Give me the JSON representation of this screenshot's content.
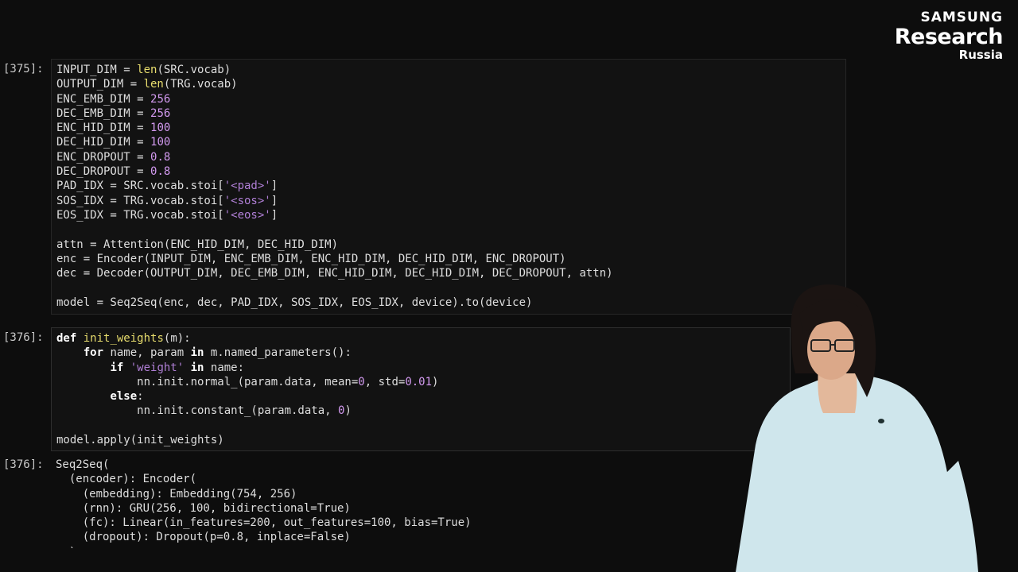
{
  "logo": {
    "line1": "SAMSUNG",
    "line2": "Research",
    "line3": "Russia"
  },
  "cells": {
    "c375": {
      "prompt": "[375]:",
      "lines": [
        [
          {
            "t": "INPUT_DIM = "
          },
          {
            "t": "len",
            "c": "fn"
          },
          {
            "t": "(SRC.vocab)"
          }
        ],
        [
          {
            "t": "OUTPUT_DIM = "
          },
          {
            "t": "len",
            "c": "fn"
          },
          {
            "t": "(TRG.vocab)"
          }
        ],
        [
          {
            "t": "ENC_EMB_DIM = "
          },
          {
            "t": "256",
            "c": "num"
          }
        ],
        [
          {
            "t": "DEC_EMB_DIM = "
          },
          {
            "t": "256",
            "c": "num"
          }
        ],
        [
          {
            "t": "ENC_HID_DIM = "
          },
          {
            "t": "100",
            "c": "num"
          }
        ],
        [
          {
            "t": "DEC_HID_DIM = "
          },
          {
            "t": "100",
            "c": "num"
          }
        ],
        [
          {
            "t": "ENC_DROPOUT = "
          },
          {
            "t": "0.8",
            "c": "num"
          }
        ],
        [
          {
            "t": "DEC_DROPOUT = "
          },
          {
            "t": "0.8",
            "c": "num"
          }
        ],
        [
          {
            "t": "PAD_IDX = SRC.vocab.stoi["
          },
          {
            "t": "'<pad>'",
            "c": "str"
          },
          {
            "t": "]"
          }
        ],
        [
          {
            "t": "SOS_IDX = TRG.vocab.stoi["
          },
          {
            "t": "'<sos>'",
            "c": "str"
          },
          {
            "t": "]"
          }
        ],
        [
          {
            "t": "EOS_IDX = TRG.vocab.stoi["
          },
          {
            "t": "'<eos>'",
            "c": "str"
          },
          {
            "t": "]"
          }
        ],
        [],
        [
          {
            "t": "attn = Attention(ENC_HID_DIM, DEC_HID_DIM)"
          }
        ],
        [
          {
            "t": "enc = Encoder(INPUT_DIM, ENC_EMB_DIM, ENC_HID_DIM, DEC_HID_DIM, ENC_DROPOUT)"
          }
        ],
        [
          {
            "t": "dec = Decoder(OUTPUT_DIM, DEC_EMB_DIM, ENC_HID_DIM, DEC_HID_DIM, DEC_DROPOUT, attn)"
          }
        ],
        [],
        [
          {
            "t": "model = Seq2Seq(enc, dec, PAD_IDX, SOS_IDX, EOS_IDX, device).to(device)"
          }
        ]
      ]
    },
    "c376": {
      "prompt": "[376]:",
      "lines": [
        [
          {
            "t": "def",
            "c": "kw"
          },
          {
            "t": " "
          },
          {
            "t": "init_weights",
            "c": "fn"
          },
          {
            "t": "(m):"
          }
        ],
        [
          {
            "t": "    "
          },
          {
            "t": "for",
            "c": "kw"
          },
          {
            "t": " name, param "
          },
          {
            "t": "in",
            "c": "kw"
          },
          {
            "t": " m.named_parameters():"
          }
        ],
        [
          {
            "t": "        "
          },
          {
            "t": "if",
            "c": "kw"
          },
          {
            "t": " "
          },
          {
            "t": "'weight'",
            "c": "str"
          },
          {
            "t": " "
          },
          {
            "t": "in",
            "c": "kw"
          },
          {
            "t": " name:"
          }
        ],
        [
          {
            "t": "            nn.init.normal_(param.data, mean="
          },
          {
            "t": "0",
            "c": "num"
          },
          {
            "t": ", std="
          },
          {
            "t": "0.01",
            "c": "num"
          },
          {
            "t": ")"
          }
        ],
        [
          {
            "t": "        "
          },
          {
            "t": "else",
            "c": "kw"
          },
          {
            "t": ":"
          }
        ],
        [
          {
            "t": "            nn.init.constant_(param.data, "
          },
          {
            "t": "0",
            "c": "num"
          },
          {
            "t": ")"
          }
        ],
        [],
        [
          {
            "t": "model.apply(init_weights)"
          }
        ]
      ]
    },
    "out376": {
      "prompt": "[376]:",
      "lines": [
        "Seq2Seq(",
        "  (encoder): Encoder(",
        "    (embedding): Embedding(754, 256)",
        "    (rnn): GRU(256, 100, bidirectional=True)",
        "    (fc): Linear(in_features=200, out_features=100, bias=True)",
        "    (dropout): Dropout(p=0.8, inplace=False)",
        "  )"
      ]
    }
  }
}
